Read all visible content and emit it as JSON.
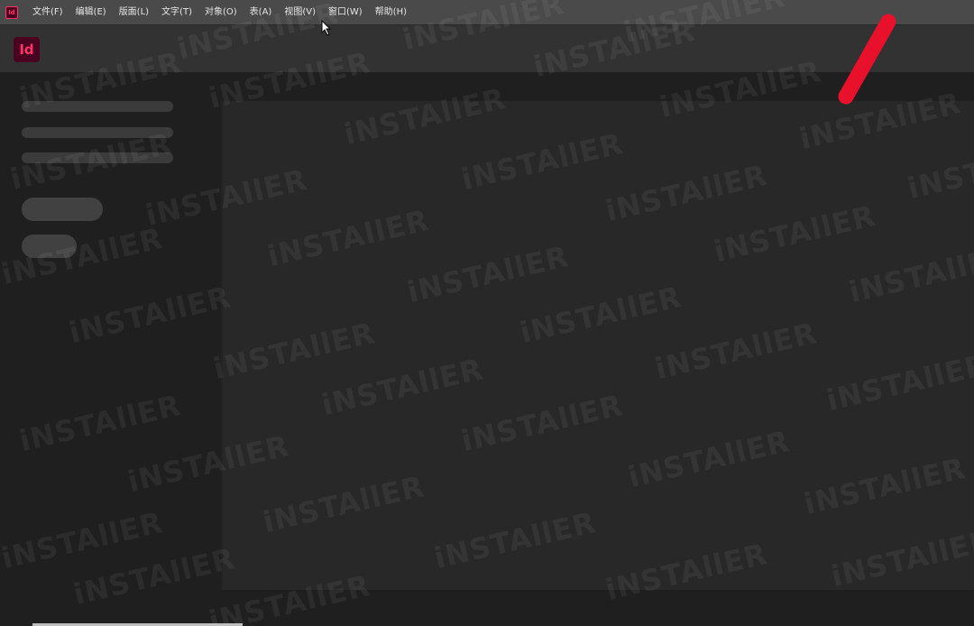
{
  "app": {
    "logo_text": "Id",
    "mini_icon_text": "Id",
    "brand_color": "#ff3366",
    "brand_bg": "#49021f"
  },
  "menubar": {
    "items": [
      {
        "label": "文件(F)"
      },
      {
        "label": "编辑(E)"
      },
      {
        "label": "版面(L)"
      },
      {
        "label": "文字(T)"
      },
      {
        "label": "对象(O)"
      },
      {
        "label": "表(A)"
      },
      {
        "label": "视图(V)"
      },
      {
        "label": "窗口(W)"
      },
      {
        "label": "帮助(H)"
      }
    ]
  },
  "watermark": {
    "text": "iNSTAllER"
  },
  "annotation": {
    "color": "#e8102a"
  },
  "icons": {
    "cursor": "arrow-cursor-icon",
    "logo": "indesign-logo-icon"
  }
}
